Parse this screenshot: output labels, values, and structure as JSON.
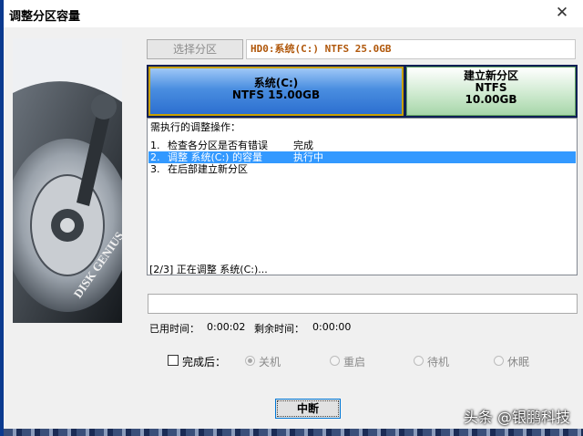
{
  "window": {
    "title": "调整分区容量",
    "close_label": "✕"
  },
  "disk_graphic": {
    "brand_text": "DISK GENIUS"
  },
  "toolbar": {
    "select_partition_label": "选择分区",
    "disk_info": "HD0:系统(C:) NTFS 25.0GB"
  },
  "partitions": [
    {
      "name": "系统(C:)",
      "fs": "NTFS 15.00GB",
      "size": ""
    },
    {
      "name": "建立新分区",
      "fs": "NTFS",
      "size": "10.00GB"
    }
  ],
  "operations": {
    "header": "需执行的调整操作：",
    "items": [
      {
        "num": "1.",
        "text": "检查各分区是否有错误",
        "status": "完成"
      },
      {
        "num": "2.",
        "text": "调整 系统(C:) 的容量",
        "status": "执行中"
      },
      {
        "num": "3.",
        "text": "在后部建立新分区",
        "status": ""
      }
    ]
  },
  "progress": {
    "text": "[2/3] 正在调整 系统(C:)...",
    "fraction": 0
  },
  "time": {
    "elapsed_label": "已用时间：",
    "elapsed_value": "0:00:02",
    "remaining_label": "剩余时间：",
    "remaining_value": "0:00:00"
  },
  "after_completion": {
    "label": "完成后：",
    "checked": false,
    "options": [
      "关机",
      "重启",
      "待机",
      "休眠"
    ],
    "selected": "关机"
  },
  "buttons": {
    "abort_label": "中断"
  },
  "watermark": "头条 @银鹏科技"
}
